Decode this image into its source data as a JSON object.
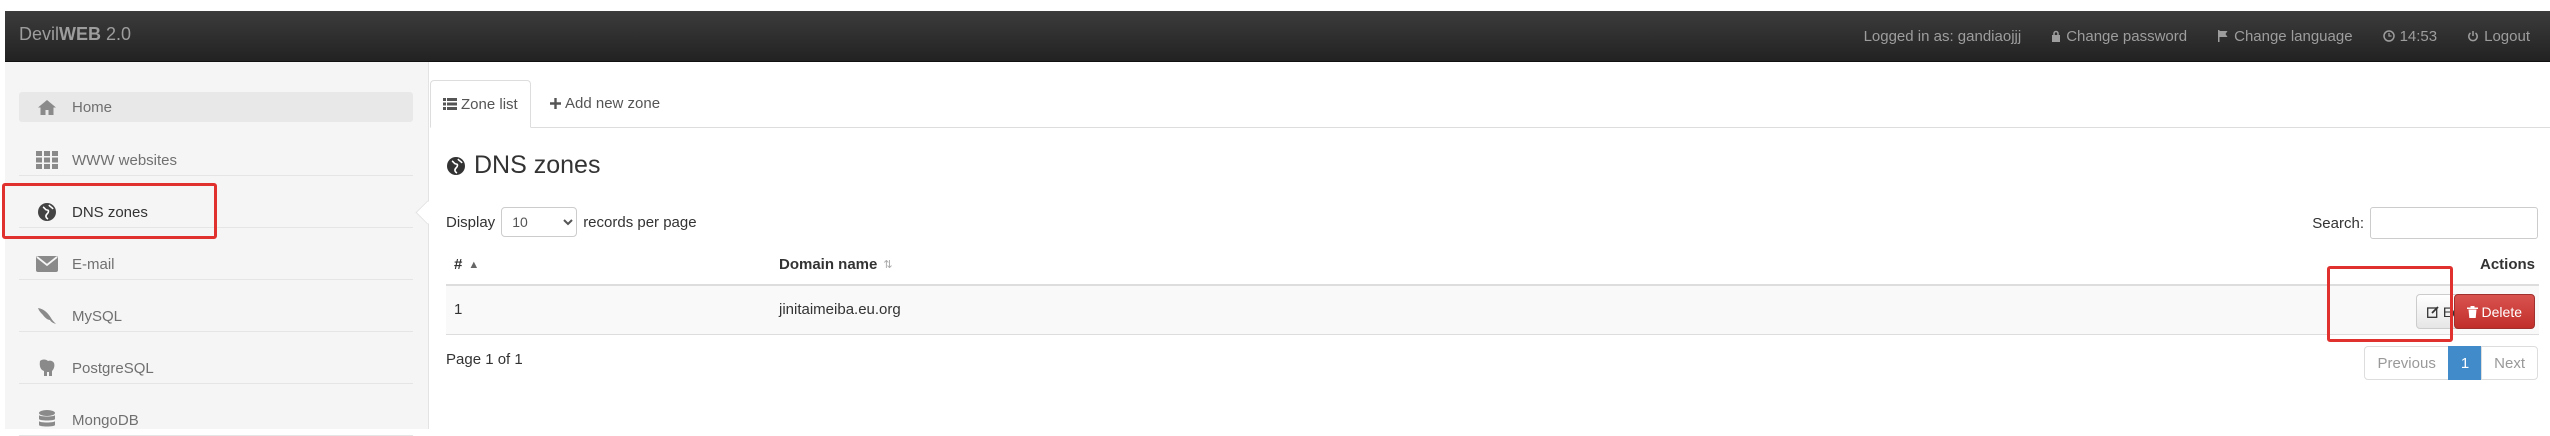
{
  "app": {
    "brand_plain": "Devil",
    "brand_bold": "WEB",
    "brand_version": " 2.0"
  },
  "navbar": {
    "logged_in": "Logged in as: gandiaojjj",
    "change_password": "Change password",
    "change_language": "Change language",
    "time": "14:53",
    "logout": "Logout"
  },
  "sidebar": {
    "items": [
      {
        "label": "Home",
        "icon": "home-icon"
      },
      {
        "label": "WWW websites",
        "icon": "grid-icon"
      },
      {
        "label": "DNS zones",
        "icon": "globe-icon"
      },
      {
        "label": "E-mail",
        "icon": "envelope-icon"
      },
      {
        "label": "MySQL",
        "icon": "dolphin-icon"
      },
      {
        "label": "PostgreSQL",
        "icon": "elephant-icon"
      },
      {
        "label": "MongoDB",
        "icon": "database-icon"
      }
    ]
  },
  "tabs": {
    "zone_list": "Zone list",
    "add_new_zone": "Add new zone"
  },
  "main": {
    "title": "DNS zones",
    "display_prefix": "Display",
    "display_value": "10",
    "display_suffix": "records per page",
    "search_label": "Search:"
  },
  "table": {
    "headers": {
      "num": "#",
      "domain": "Domain name",
      "actions": "Actions"
    },
    "rows": [
      {
        "num": "1",
        "domain": "jinitaimeiba.eu.org"
      }
    ],
    "edit_label": "Edit",
    "delete_label": "Delete"
  },
  "pagination": {
    "info": "Page 1 of 1",
    "previous": "Previous",
    "current": "1",
    "next": "Next"
  },
  "colors": {
    "highlight": "#e0312e",
    "delete": "#d9534f",
    "active_page": "#428bca"
  }
}
